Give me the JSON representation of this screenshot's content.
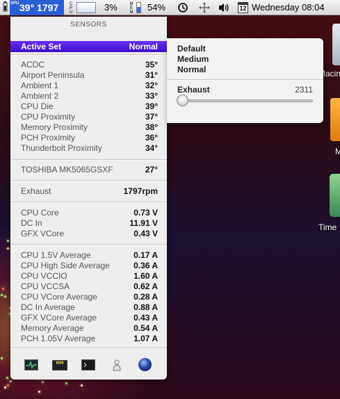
{
  "menubar": {
    "sensor_temp_value": "39° 1797",
    "sensor_tiny_label": "S\nP\nU",
    "cpu_tiny_label": "C\nP\nU",
    "cpu_percent": "3%",
    "mem_tiny_label": "M\nE\nM",
    "mem_percent": "54%",
    "mem_fraction": 0.54,
    "calendar_day": "12",
    "clock": "Wednesday 08:04",
    "icons": [
      "battery-icon",
      "time-machine-icon",
      "bluetooth-icon",
      "volume-icon",
      "calendar-icon"
    ]
  },
  "panel": {
    "title": "SENSORS",
    "active_set": {
      "label": "Active Set",
      "value": "Normal"
    },
    "temps": [
      {
        "label": "ACDC",
        "value": "35°"
      },
      {
        "label": "Airport Peninsula",
        "value": "31°"
      },
      {
        "label": "Ambient 1",
        "value": "32°"
      },
      {
        "label": "Ambient 2",
        "value": "33°"
      },
      {
        "label": "CPU Die",
        "value": "39°"
      },
      {
        "label": "CPU Proximity",
        "value": "37°"
      },
      {
        "label": "Memory Proximity",
        "value": "38°"
      },
      {
        "label": "PCH Proximity",
        "value": "36°"
      },
      {
        "label": "Thunderbolt Proximity",
        "value": "34°"
      }
    ],
    "disk": {
      "label": "TOSHIBA MK5065GSXF",
      "value": "27°"
    },
    "fan": {
      "label": "Exhaust",
      "value": "1797rpm"
    },
    "voltages": [
      {
        "label": "CPU Core",
        "value": "0.73 V"
      },
      {
        "label": "DC In",
        "value": "11.91 V"
      },
      {
        "label": "GFX VCore",
        "value": "0.43 V"
      }
    ],
    "currents": [
      {
        "label": "CPU 1.5V Average",
        "value": "0.17 A"
      },
      {
        "label": "CPU High Side Average",
        "value": "0.36 A"
      },
      {
        "label": "CPU VCCIO",
        "value": "1.60 A"
      },
      {
        "label": "CPU VCCSA",
        "value": "0.62 A"
      },
      {
        "label": "CPU VCore Average",
        "value": "0.28 A"
      },
      {
        "label": "DC In Average",
        "value": "0.88 A"
      },
      {
        "label": "GFX VCore Average",
        "value": "0.43 A"
      },
      {
        "label": "Memory Average",
        "value": "0.54 A"
      },
      {
        "label": "PCH 1.05V Average",
        "value": "1.07 A"
      }
    ],
    "toolbar": [
      "activity-monitor-icon",
      "chip-icon",
      "terminal-icon",
      "person-icon",
      "globe-icon"
    ]
  },
  "popover": {
    "options": [
      "Default",
      "Medium",
      "Normal"
    ],
    "fan_label": "Exhaust",
    "fan_max": "2311",
    "slider_fraction": 0.0
  },
  "desktop": {
    "icons": [
      {
        "label": "Macin"
      },
      {
        "label": "M"
      },
      {
        "label": "Time"
      }
    ]
  }
}
